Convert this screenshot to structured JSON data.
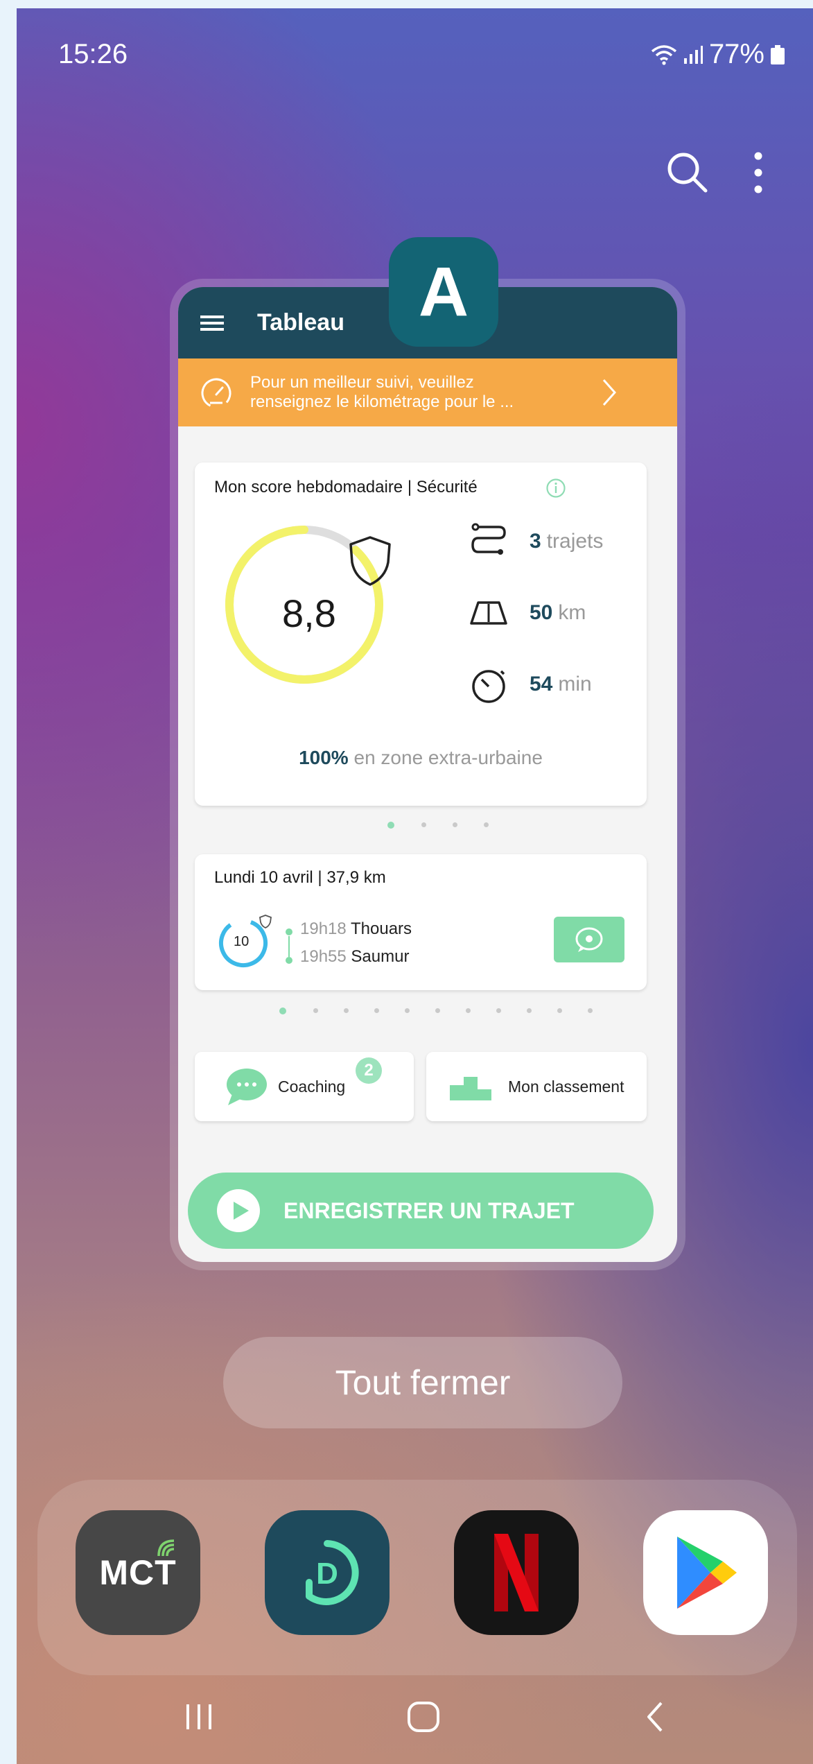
{
  "status": {
    "time": "15:26",
    "battery": "77%"
  },
  "top_actions": {
    "search_icon": "search-icon",
    "more_icon": "more-vertical-icon"
  },
  "app_card": {
    "app_badge_letter": "A",
    "header_title": "Tableau",
    "banner_text": "Pour un meilleur suivi, veuillez renseignez le kilométrage pour le ...",
    "weekly_score": {
      "title": "Mon score hebdomadaire | Sécurité",
      "score": "8,8",
      "score_fraction": 0.88,
      "trips_value": "3",
      "trips_unit": "trajets",
      "km_value": "50",
      "km_unit": "km",
      "min_value": "54",
      "min_unit": "min",
      "zone_percent": "100%",
      "zone_text": "en zone extra-urbaine"
    },
    "trip": {
      "title": "Lundi 10 avril | 37,9 km",
      "score": "10",
      "start_time": "19h18",
      "start_place": "Thouars",
      "end_time": "19h55",
      "end_place": "Saumur"
    },
    "coaching_label": "Coaching",
    "coaching_badge": "2",
    "ranking_label": "Mon classement",
    "record_label": "ENREGISTRER UN TRAJET"
  },
  "close_all_label": "Tout fermer",
  "dock": {
    "apps": [
      {
        "name": "MCT",
        "label": "MCT"
      },
      {
        "name": "D",
        "label": "D"
      },
      {
        "name": "Netflix",
        "label": "N"
      },
      {
        "name": "Play Store",
        "label": ""
      }
    ]
  },
  "colors": {
    "header": "#1e4a5c",
    "banner": "#f6a947",
    "accent_green": "#80dba7",
    "score_ring": "#f3f26a",
    "trip_ring": "#3cb9e8"
  }
}
